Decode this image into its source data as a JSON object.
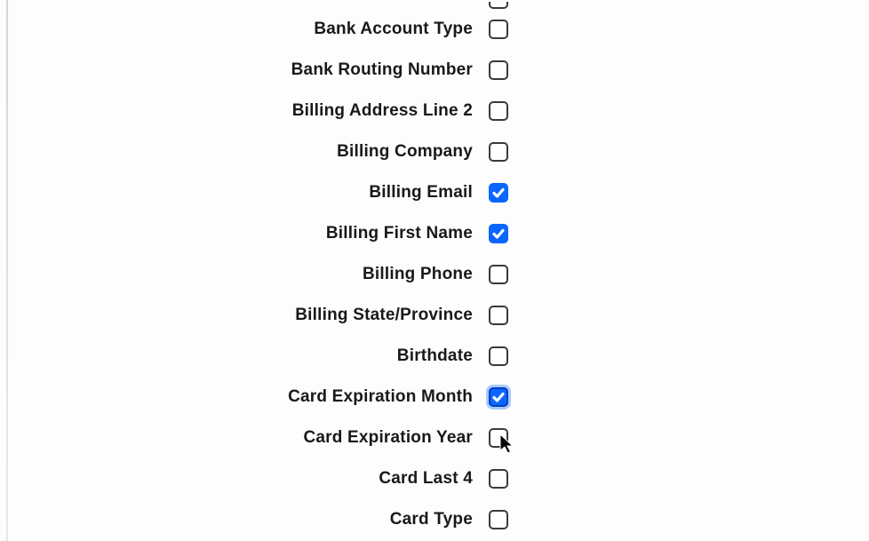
{
  "fields": [
    {
      "id": "bank-account-type",
      "label": "Bank Account Type",
      "checked": false,
      "focused": false
    },
    {
      "id": "bank-routing-number",
      "label": "Bank Routing Number",
      "checked": false,
      "focused": false
    },
    {
      "id": "billing-address-line-2",
      "label": "Billing Address Line 2",
      "checked": false,
      "focused": false
    },
    {
      "id": "billing-company",
      "label": "Billing Company",
      "checked": false,
      "focused": false
    },
    {
      "id": "billing-email",
      "label": "Billing Email",
      "checked": true,
      "focused": false
    },
    {
      "id": "billing-first-name",
      "label": "Billing First Name",
      "checked": true,
      "focused": false
    },
    {
      "id": "billing-phone",
      "label": "Billing Phone",
      "checked": false,
      "focused": false
    },
    {
      "id": "billing-state-province",
      "label": "Billing State/Province",
      "checked": false,
      "focused": false
    },
    {
      "id": "birthdate",
      "label": "Birthdate",
      "checked": false,
      "focused": false
    },
    {
      "id": "card-expiration-month",
      "label": "Card Expiration Month",
      "checked": true,
      "focused": true
    },
    {
      "id": "card-expiration-year",
      "label": "Card Expiration Year",
      "checked": false,
      "focused": false
    },
    {
      "id": "card-last-4",
      "label": "Card Last 4",
      "checked": false,
      "focused": false
    },
    {
      "id": "card-type",
      "label": "Card Type",
      "checked": false,
      "focused": false
    }
  ]
}
